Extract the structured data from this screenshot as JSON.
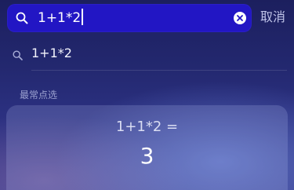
{
  "search": {
    "query": "1+1*2",
    "search_icon": "search-icon",
    "clear_icon": "clear-icon"
  },
  "cancel_label": "取消",
  "suggestion": {
    "icon": "search-icon",
    "text": "1+1*2"
  },
  "section": {
    "title": "最常点选"
  },
  "result": {
    "expression": "1+1*2 =",
    "value": "3"
  },
  "colors": {
    "search_bar_bg": "#2216c4",
    "cancel_text": "#bfc3e8",
    "section_text": "#9aa0cf"
  }
}
